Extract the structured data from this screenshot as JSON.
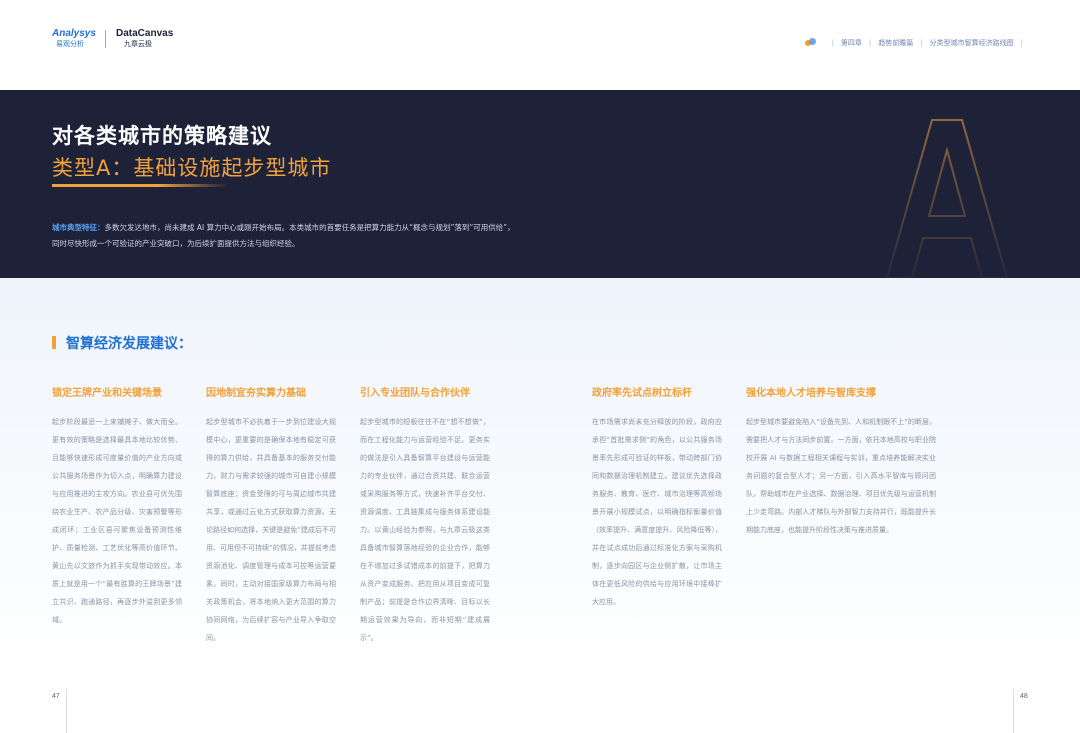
{
  "header": {
    "logo_left": {
      "line1": "Analysys",
      "line2": "易观分析"
    },
    "logo_right": {
      "line1": "DataCanvas",
      "line2": "九章云极"
    },
    "breadcrumb": [
      "第四章",
      "趋势前瞻篇",
      "分类型城市智算经济路线图"
    ]
  },
  "banner": {
    "big_letter": "A",
    "title": "对各类城市的策略建议",
    "subtitle": "类型A：基础设施起步型城市",
    "intro_lead": "城市典型特征：",
    "intro_text": "多数欠发达地市，尚未建成 AI 算力中心或刚开始布局。本类城市的首要任务是把算力能力从“概念与规划”落到“可用供给”，同时尽快形成一个可验证的产业突破口，为后续扩面提供方法与组织经验。"
  },
  "section": {
    "title": "智算经济发展建议："
  },
  "columns": [
    {
      "heading": "锁定王牌产业和关键场景",
      "body": "起步阶段最忌一上来铺摊子、做大而全。更有效的策略是选择最具本地比较优势、且能够快速形成可度量价值的产业方向或公共服务场景作为切入点，明确算力建设与应用推进的主攻方向。农业县可优先围绕农业生产、农产品分级、灾害预警等形成闭环；工业区县可聚焦设备预测性维护、质量检测、工艺优化等高价值环节。黄山先以文旅作为抓手实现带动效应。本质上就是用一个“最有胜算的王牌场景”建立共识、跑通路径，再逐步外溢到更多领域。"
    },
    {
      "heading": "因地制宜夯实算力基础",
      "body": "起步型城市不必执着于一步到位建设大规模中心，更重要的是确保本地有稳定可获得的算力供给，并具备基本的服务交付能力。财力与需求较强的城市可自建小规模智算底座；资金受限的可与周边城市共建共享，或通过云化方式获取算力资源。无论路径如何选择，关键是避免“建成后不可用、可用但不可持续”的情况，并提前考虑资源池化、调度管理与成本可控等运营要素。同时，主动对接国家级算力布局与相关政策机会，将本地纳入更大范围的算力协同网络，为后续扩容与产业导入争取空间。"
    },
    {
      "heading": "引入专业团队与合作伙伴",
      "body": "起步型城市的短板往往不在“想不想做”，而在工程化能力与运营经验不足。更务实的做法是引入具备智算平台建设与运营能力的专业伙伴，通过合资共建、联合运营或采购服务等方式，快速补齐平台交付、资源调度、工具链集成与服务体系建设能力。以黄山经验为参照，与九章云极这类具备城市智算落地经验的企业合作，能够在不增加过多试错成本的前提下，把算力从资产变成服务、把应用从项目变成可复制产品；前提是合作边界清晰、目标以长期运营效果为导向，而非短期“建成展示”。"
    },
    {
      "heading": "政府率先试点树立标杆",
      "body": "在市场需求尚未充分释放的阶段，政府应承担“首批需求侧”的角色，以公共服务场景率先形成可验证的样板，带动跨部门协同和数据治理机制建立。建议优先选择政务服务、教育、医疗、城市治理等高频场景开展小规模试点，以明确指标衡量价值（效率提升、满意度提升、风险降低等），并在试点成功后通过标准化方案与采购机制，逐步向园区与企业侧扩散，让市场主体在更低风险的供给与应用环境中接棒扩大应用。"
    },
    {
      "heading": "强化本地人才培养与智库支撑",
      "body": "起步型城市要避免陷入“设备先到、人和机制跟不上”的断层，需要把人才与方法同步前置。一方面，依托本地高校与职业院校开展 AI 与数据工程相关课程与实训，重点培养能解决实业务问题的复合型人才；另一方面，引入高水平智库与顾问团队，帮助城市在产业选择、数据治理、项目优先级与运营机制上少走弯路。内部人才梯队与外部智力支持并行，既能提升长期能力底座，也能提升阶段性决策与推进质量。"
    }
  ],
  "footer": {
    "page_left": "47",
    "page_right": "48"
  }
}
